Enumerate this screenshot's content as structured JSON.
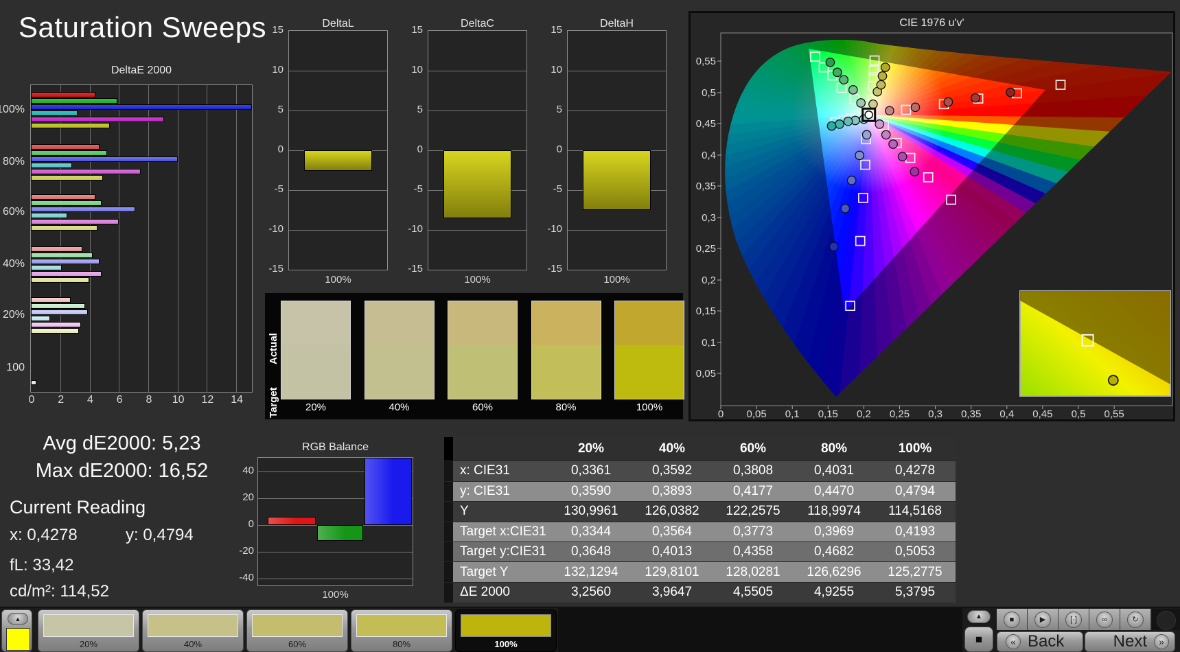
{
  "window": {
    "title": "Saturation Sweeps"
  },
  "stats": {
    "avg": "Avg dE2000: 5,23",
    "max": "Max dE2000: 16,52",
    "current_heading": "Current Reading",
    "x": "x: 0,4278",
    "y": "y: 0,4794",
    "fl": "fL: 33,42",
    "cdm2": "cd/m²: 114,52"
  },
  "swatch_panel": {
    "row_labels": [
      "Actual",
      "Target"
    ],
    "items": [
      {
        "label": "20%",
        "actual": "#c6c3a9",
        "target": "#c3c2a4"
      },
      {
        "label": "40%",
        "actual": "#c7bd92",
        "target": "#c2c08e"
      },
      {
        "label": "60%",
        "actual": "#c9b87c",
        "target": "#bfbf76"
      },
      {
        "label": "80%",
        "actual": "#cbb25f",
        "target": "#c2bf5b"
      },
      {
        "label": "100%",
        "actual": "#c2a72e",
        "target": "#bfbb0e"
      }
    ]
  },
  "table": {
    "headers": [
      "20%",
      "40%",
      "60%",
      "80%",
      "100%"
    ],
    "rows": [
      {
        "label": "x: CIE31",
        "bg": "#4a4a4a",
        "values": [
          "0,3361",
          "0,3592",
          "0,3808",
          "0,4031",
          "0,4278"
        ]
      },
      {
        "label": "y: CIE31",
        "bg": "#8d8d8d",
        "values": [
          "0,3590",
          "0,3893",
          "0,4177",
          "0,4470",
          "0,4794"
        ]
      },
      {
        "label": "Y",
        "bg": "#3a3a3a",
        "values": [
          "130,9961",
          "126,0382",
          "122,2575",
          "118,9974",
          "114,5168"
        ]
      },
      {
        "label": "Target x:CIE31",
        "bg": "#8d8d8d",
        "values": [
          "0,3344",
          "0,3564",
          "0,3773",
          "0,3969",
          "0,4193"
        ]
      },
      {
        "label": "Target y:CIE31",
        "bg": "#6e6e6e",
        "values": [
          "0,3648",
          "0,4013",
          "0,4358",
          "0,4682",
          "0,5053"
        ]
      },
      {
        "label": "Target Y",
        "bg": "#8d8d8d",
        "values": [
          "132,1294",
          "129,8101",
          "128,0281",
          "126,6296",
          "125,2775"
        ]
      },
      {
        "label": "ΔE 2000",
        "bg": "#3a3a3a",
        "values": [
          "3,2560",
          "3,9647",
          "4,5505",
          "4,9255",
          "5,3795"
        ]
      }
    ]
  },
  "bottom_bar": {
    "current_patch_color": "#ffff00",
    "up_glyph": "▲",
    "patches": [
      {
        "label": "20%",
        "color": "#c6c6a7",
        "selected": false
      },
      {
        "label": "40%",
        "color": "#c5c189",
        "selected": false
      },
      {
        "label": "60%",
        "color": "#c5bd6e",
        "selected": false
      },
      {
        "label": "80%",
        "color": "#c4bd55",
        "selected": false
      },
      {
        "label": "100%",
        "color": "#bdb40e",
        "selected": true
      }
    ],
    "stop_big_glyph": "■",
    "transport": [
      {
        "name": "stop",
        "glyph": "■"
      },
      {
        "name": "play",
        "glyph": "▶"
      },
      {
        "name": "single-measure",
        "glyph": "[·]"
      },
      {
        "name": "continuous",
        "glyph": "∞"
      },
      {
        "name": "loop",
        "glyph": "↻"
      }
    ],
    "back": "Back",
    "next": "Next",
    "back_glyph": "«",
    "next_glyph": "»"
  },
  "chart_data": [
    {
      "id": "deltae2000",
      "type": "bar",
      "orientation": "horizontal",
      "title": "DeltaE 2000",
      "xlim": [
        0,
        15.07
      ],
      "x_ticks": [
        0,
        2,
        4,
        6,
        8,
        10,
        12,
        14
      ],
      "groups": [
        "100%",
        "80%",
        "60%",
        "40%",
        "20%"
      ],
      "group_tints": [
        0,
        0.22,
        0.38,
        0.52,
        0.68
      ],
      "series": [
        {
          "name": "red",
          "color": "#c81414",
          "values": [
            4.4,
            4.7,
            4.4,
            3.5,
            2.7
          ]
        },
        {
          "name": "green",
          "color": "#18b42a",
          "values": [
            5.9,
            5.2,
            4.8,
            4.2,
            3.7
          ]
        },
        {
          "name": "blue",
          "color": "#1c24d8",
          "values": [
            16.52,
            10.0,
            7.1,
            4.7,
            3.9
          ]
        },
        {
          "name": "cyan",
          "color": "#20b2b2",
          "values": [
            3.2,
            2.8,
            2.5,
            2.1,
            1.3
          ]
        },
        {
          "name": "magenta",
          "color": "#c022c4",
          "values": [
            9.1,
            7.5,
            6.0,
            4.8,
            3.4
          ]
        },
        {
          "name": "yellow",
          "color": "#bcbc1c",
          "values": [
            5.38,
            4.93,
            4.55,
            3.96,
            3.26
          ]
        }
      ],
      "luminance_row": {
        "label": "100",
        "value": 0.35,
        "color": "#e8e8e8"
      }
    },
    {
      "id": "deltaL",
      "type": "bar",
      "title": "DeltaL",
      "categories": [
        "100%"
      ],
      "values": [
        -2.6
      ],
      "ylim": [
        -15,
        15
      ],
      "y_ticks": [
        15,
        10,
        5,
        0,
        -5,
        -10,
        -15
      ],
      "bar_color_top": "#d8d520",
      "bar_color_bottom": "#827f0d"
    },
    {
      "id": "deltaC",
      "type": "bar",
      "title": "DeltaC",
      "categories": [
        "100%"
      ],
      "values": [
        -8.5
      ],
      "ylim": [
        -15,
        15
      ],
      "y_ticks": [
        15,
        10,
        5,
        0,
        -5,
        -10,
        -15
      ],
      "bar_color_top": "#d8d520",
      "bar_color_bottom": "#827f0d"
    },
    {
      "id": "deltaH",
      "type": "bar",
      "title": "DeltaH",
      "categories": [
        "100%"
      ],
      "values": [
        -7.5
      ],
      "ylim": [
        -15,
        15
      ],
      "y_ticks": [
        15,
        10,
        5,
        0,
        -5,
        -10,
        -15
      ],
      "bar_color_top": "#d8d520",
      "bar_color_bottom": "#827f0d"
    },
    {
      "id": "rgb_balance",
      "type": "bar",
      "title": "RGB Balance",
      "categories": [
        "100%"
      ],
      "ylim": [
        -45,
        50
      ],
      "y_ticks": [
        40,
        20,
        0,
        -20,
        -40
      ],
      "series": [
        {
          "name": "red",
          "color": "#dd1515",
          "value": 6
        },
        {
          "name": "green",
          "color": "#169616",
          "value": -12
        },
        {
          "name": "blue",
          "color": "#1a1aee",
          "value": 50
        }
      ]
    },
    {
      "id": "cie1976",
      "type": "scatter",
      "title": "CIE 1976 u'v'",
      "x_tick_values": [
        0,
        0.05,
        0.1,
        0.15,
        0.2,
        0.25,
        0.3,
        0.35,
        0.4,
        0.45,
        0.5,
        0.55
      ],
      "x_tick_labels": [
        "0",
        "0,05",
        "0,1",
        "0,15",
        "0,2",
        "0,25",
        "0,3",
        "0,35",
        "0,4",
        "0,45",
        "0,5",
        "0,55"
      ],
      "y_tick_values": [
        0.55,
        0.5,
        0.45,
        0.4,
        0.35,
        0.3,
        0.25,
        0.2,
        0.15,
        0.1,
        0.05
      ],
      "y_tick_labels": [
        "0,55",
        "0,5",
        "0,45",
        "0,4",
        "0,35",
        "0,3",
        "0,25",
        "0,2",
        "0,15",
        "0,1",
        "0,05"
      ],
      "white_point": [
        0.207,
        0.464
      ],
      "branches": [
        {
          "name": "red",
          "colors": [
            "#c58585",
            "#bc6a6a",
            "#ad4f4f",
            "#a13c3c",
            "#8f2525"
          ],
          "targets": [
            [
              0.259,
              0.472
            ],
            [
              0.312,
              0.481
            ],
            [
              0.36,
              0.49
            ],
            [
              0.414,
              0.4985
            ],
            [
              0.475,
              0.512
            ]
          ],
          "measured": [
            [
              0.236,
              0.4705
            ],
            [
              0.272,
              0.476
            ],
            [
              0.318,
              0.4845
            ],
            [
              0.356,
              0.491
            ],
            [
              0.405,
              0.5
            ]
          ]
        },
        {
          "name": "green",
          "colors": [
            "#9ec9ae",
            "#7cc08f",
            "#5bb573",
            "#3fae5e",
            "#2aa24c"
          ],
          "targets": [
            [
              0.187,
              0.489
            ],
            [
              0.169,
              0.507
            ],
            [
              0.156,
              0.527
            ],
            [
              0.144,
              0.54
            ],
            [
              0.132,
              0.557
            ]
          ],
          "measured": [
            [
              0.196,
              0.483
            ],
            [
              0.185,
              0.504
            ],
            [
              0.172,
              0.52
            ],
            [
              0.163,
              0.532
            ],
            [
              0.153,
              0.548
            ]
          ]
        },
        {
          "name": "blue",
          "colors": [
            "#9aa4d6",
            "#7e8cd0",
            "#5f6fc8",
            "#4a57c0",
            "#2330b0"
          ],
          "targets": [
            [
              0.203,
              0.425
            ],
            [
              0.202,
              0.384
            ],
            [
              0.199,
              0.331
            ],
            [
              0.195,
              0.262
            ],
            [
              0.181,
              0.158
            ]
          ],
          "measured": [
            [
              0.204,
              0.432
            ],
            [
              0.194,
              0.399
            ],
            [
              0.183,
              0.359
            ],
            [
              0.174,
              0.314
            ],
            [
              0.158,
              0.253
            ]
          ]
        },
        {
          "name": "cyan",
          "colors": [
            "#9fd0cc",
            "#83c8c2",
            "#62bdb6",
            "#45b5ac",
            "#2aada2"
          ],
          "targets": [
            [
              0.2,
              0.464
            ],
            [
              0.192,
              0.462
            ],
            [
              0.182,
              0.458
            ],
            [
              0.172,
              0.455
            ],
            [
              0.16,
              0.452
            ]
          ],
          "measured": [
            [
              0.2,
              0.457
            ],
            [
              0.188,
              0.455
            ],
            [
              0.178,
              0.4535
            ],
            [
              0.166,
              0.449
            ],
            [
              0.155,
              0.446
            ]
          ]
        },
        {
          "name": "magenta",
          "colors": [
            "#cf9ad0",
            "#c77fc8",
            "#bd63be",
            "#b04ab2",
            "#a131a3"
          ],
          "targets": [
            [
              0.228,
              0.447
            ],
            [
              0.246,
              0.419
            ],
            [
              0.265,
              0.395
            ],
            [
              0.29,
              0.364
            ],
            [
              0.322,
              0.328
            ]
          ],
          "measured": [
            [
              0.222,
              0.449
            ],
            [
              0.231,
              0.432
            ],
            [
              0.241,
              0.417
            ],
            [
              0.254,
              0.397
            ],
            [
              0.271,
              0.373
            ]
          ]
        },
        {
          "name": "yellow",
          "colors": [
            "#d0cc8f",
            "#c9c273",
            "#c2b958",
            "#bcb13e",
            "#b5a825"
          ],
          "targets": [
            [
              0.212,
              0.488
            ],
            [
              0.213,
              0.51
            ],
            [
              0.214,
              0.524
            ],
            [
              0.214,
              0.535
            ],
            [
              0.215,
              0.551
            ]
          ],
          "measured": [
            [
              0.213,
              0.481
            ],
            [
              0.219,
              0.501
            ],
            [
              0.224,
              0.512
            ],
            [
              0.226,
              0.526
            ],
            [
              0.23,
              0.54
            ]
          ]
        }
      ],
      "inset": {
        "gradient": [
          "#9ae000",
          "#f2f200",
          "#f0a400"
        ],
        "dark_overlay": "#6f6200",
        "marker_square": [
          0.45,
          0.47
        ],
        "marker_circle": [
          0.62,
          0.85
        ],
        "circle_fill": "#b8b000"
      }
    }
  ]
}
